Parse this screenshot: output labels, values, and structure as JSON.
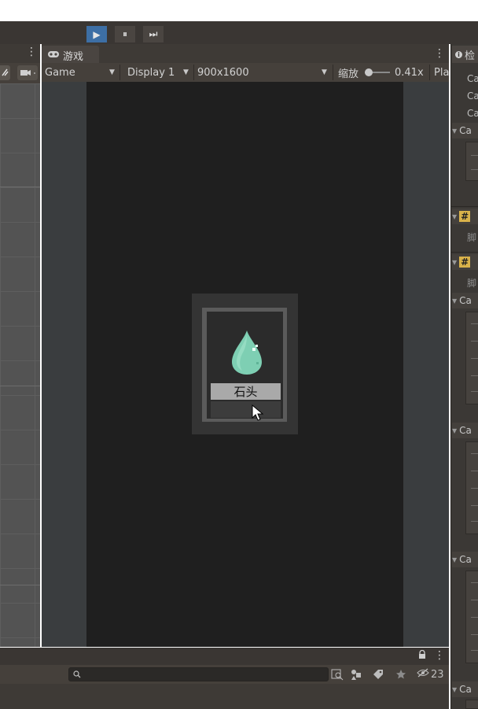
{
  "playbar": {
    "play": "▶",
    "pause": "⏸",
    "step": "⏭",
    "colors": {
      "active_bg": "#3d6fa5",
      "inactive_bg": "#4a4541"
    }
  },
  "game_tab": {
    "icon": "gamepad-icon",
    "label": "游戏",
    "menu_glyph": "⋮"
  },
  "game_toolbar": {
    "mode_select": "Game",
    "display_select": "Display 1",
    "resolution_select": "900x1600",
    "scale_label": "缩放",
    "scale_value": "0.41x",
    "play_focus_partial": "Pla"
  },
  "game_view": {
    "card_name": "石头",
    "item_icon": "water-drop-icon"
  },
  "scene_panel": {
    "menu_glyph": "⋮",
    "gizmo_icon": "gizmo-icon",
    "camera_icon": "camera-icon"
  },
  "inspector": {
    "tab_icon": "info-icon",
    "tab_label": "检",
    "rows": [
      "Ca",
      "Ca",
      "Ca"
    ],
    "components": [
      {
        "label": "Ca"
      },
      {
        "label": "#"
      },
      {
        "label": "脚"
      },
      {
        "label": "#"
      },
      {
        "label": "脚"
      },
      {
        "label": "Ca"
      },
      {
        "label": "Ca"
      },
      {
        "label": "Ca"
      },
      {
        "label": "Ca"
      }
    ]
  },
  "bottom_panel": {
    "lock_glyph": "🔒",
    "menu_glyph": "⋮",
    "search_placeholder": "",
    "hidden_count": "23"
  }
}
